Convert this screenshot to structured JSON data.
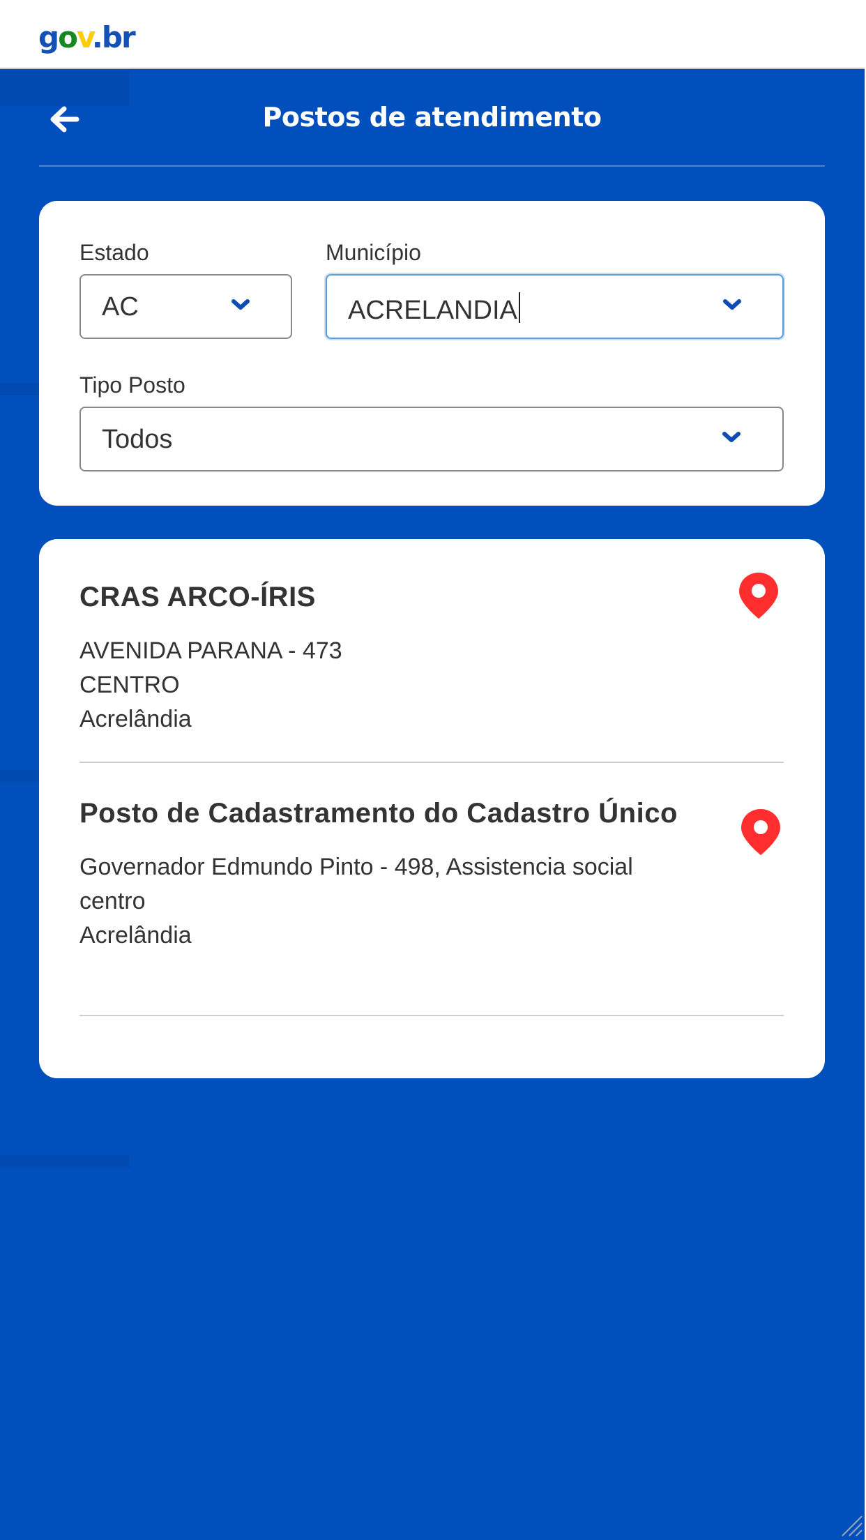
{
  "brand": {
    "logo_parts": [
      "g",
      "o",
      "v",
      ".",
      "b",
      "r"
    ]
  },
  "header": {
    "title": "Postos de atendimento",
    "back_icon": "arrow-left-icon"
  },
  "filters": {
    "estado": {
      "label": "Estado",
      "value": "AC"
    },
    "municipio": {
      "label": "Município",
      "value": "ACRELANDIA"
    },
    "tipo_posto": {
      "label": "Tipo Posto",
      "value": "Todos"
    },
    "caret_icon": "chevron-down-icon"
  },
  "results": [
    {
      "name": "CRAS ARCO-ÍRIS",
      "address_lines": [
        "AVENIDA PARANA - 473",
        "CENTRO",
        "Acrelândia"
      ]
    },
    {
      "name": "Posto de Cadastramento do Cadastro Único",
      "address_lines": [
        "Governador Edmundo Pinto - 498, Assistencia social",
        "centro",
        "Acrelândia"
      ]
    }
  ],
  "colors": {
    "brand_blue": "#004fbd",
    "pin_red": "#ff2e2e",
    "caret_blue": "#0c4cb3",
    "logo_blue": "#1351b4",
    "logo_green": "#168821",
    "logo_yellow": "#ffcd07"
  }
}
